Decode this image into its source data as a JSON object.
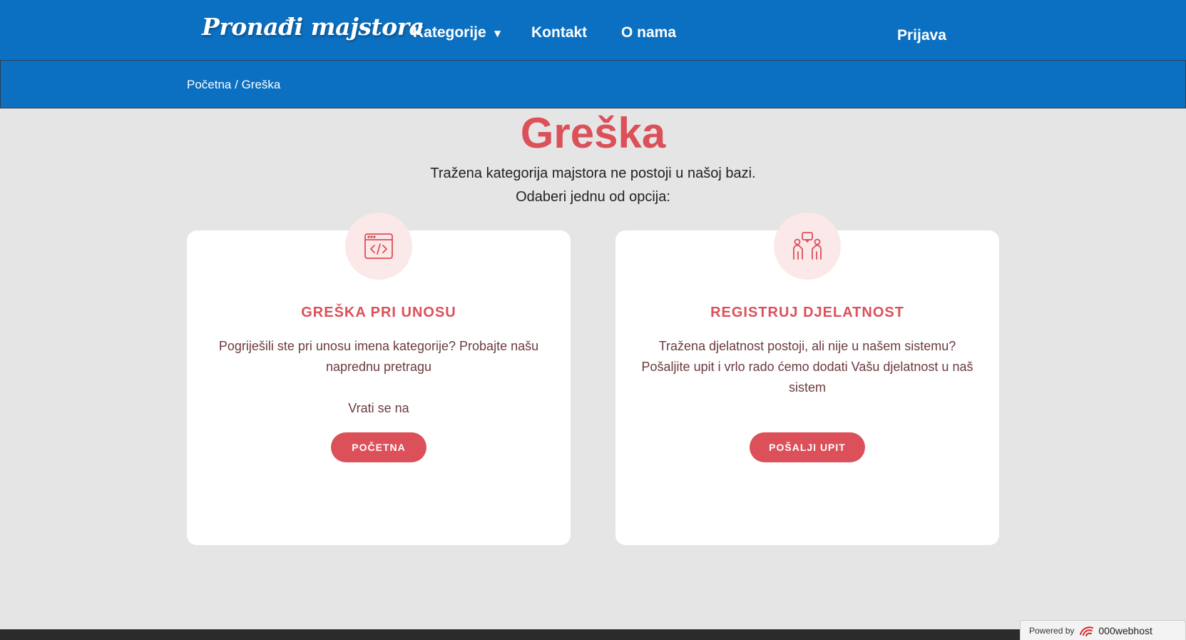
{
  "header": {
    "logo": "Pronađi majstora",
    "nav": {
      "kategorije": "Kategorije",
      "kontakt": "Kontakt",
      "o_nama": "O nama",
      "prijava": "Prijava"
    }
  },
  "breadcrumb": {
    "home": "Početna",
    "separator": " / ",
    "current": "Greška"
  },
  "main": {
    "title": "Greška",
    "line1": "Tražena kategorija majstora ne postoji u našoj bazi.",
    "line2": "Odaberi jednu od opcija:"
  },
  "cards": [
    {
      "icon": "code-window-icon",
      "title": "GREŠKA PRI UNOSU",
      "text": "Pogriješili ste pri unosu imena kategorije? Probajte našu naprednu pretragu",
      "text2": "Vrati se na",
      "button": "POČETNA"
    },
    {
      "icon": "people-chat-icon",
      "title": "REGISTRUJ DJELATNOST",
      "text": "Tražena djelatnost postoji, ali nije u našem sistemu? Pošaljite upit i vrlo rado ćemo dodati Vašu djelatnost u naš sistem",
      "button": "POŠALJI UPIT"
    }
  ],
  "footer": {
    "powered_by": "Powered by",
    "brand": "000webhost"
  },
  "colors": {
    "header_blue": "#0b70c1",
    "accent_red": "#dc5059",
    "page_bg": "#e6e5e6"
  }
}
